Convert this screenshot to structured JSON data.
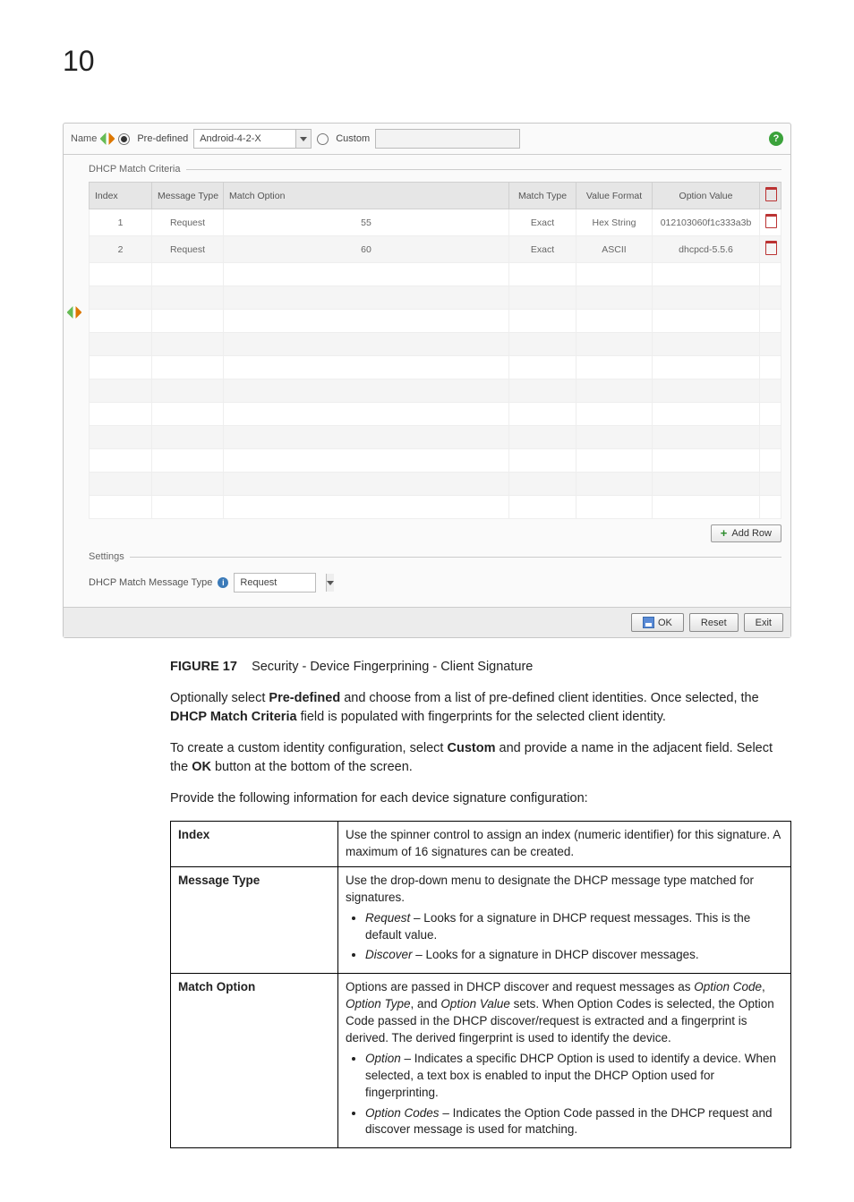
{
  "page_number": "10",
  "panel": {
    "name_label": "Name",
    "predefined_label": "Pre-defined",
    "predefined_value": "Android-4-2-X",
    "custom_label": "Custom",
    "fieldset_title": "DHCP Match Criteria",
    "headers": {
      "index": "Index",
      "message_type": "Message Type",
      "match_option": "Match Option",
      "match_type": "Match Type",
      "value_format": "Value Format",
      "option_value": "Option Value"
    },
    "rows": [
      {
        "index": "1",
        "message_type": "Request",
        "match_option": "55",
        "match_type": "Exact",
        "value_format": "Hex String",
        "option_value": "012103060f1c333a3b"
      },
      {
        "index": "2",
        "message_type": "Request",
        "match_option": "60",
        "match_type": "Exact",
        "value_format": "ASCII",
        "option_value": "dhcpcd-5.5.6"
      }
    ],
    "add_row_label": "Add Row",
    "settings_title": "Settings",
    "settings_field_label": "DHCP Match Message Type",
    "settings_field_value": "Request",
    "buttons": {
      "ok": "OK",
      "reset": "Reset",
      "exit": "Exit"
    }
  },
  "figure": {
    "id": "FIGURE 17",
    "caption": "Security - Device Fingerprining - Client Signature"
  },
  "paragraphs": {
    "p1a": "Optionally select ",
    "p1b": "Pre-defined",
    "p1c": " and choose from a list of pre-defined client identities. Once selected, the ",
    "p1d": "DHCP Match Criteria",
    "p1e": " field is populated with fingerprints for the selected client identity.",
    "p2a": "To create a custom identity configuration, select ",
    "p2b": "Custom",
    "p2c": " and provide a name in the adjacent field. Select the ",
    "p2d": "OK",
    "p2e": " button at the bottom of the screen.",
    "p3": "Provide the following information for each device signature configuration:"
  },
  "desc_table": {
    "index": {
      "k": "Index",
      "v": "Use the spinner control to assign an index (numeric identifier) for this signature. A maximum of 16 signatures can be created."
    },
    "message_type": {
      "k": "Message Type",
      "intro": "Use the drop-down menu to designate the DHCP message type matched for signatures.",
      "li1_em": "Request",
      "li1_rest": " – Looks for a signature in DHCP request messages. This is the default value.",
      "li2_em": "Discover",
      "li2_rest": " – Looks for a signature in DHCP discover messages."
    },
    "match_option": {
      "k": "Match Option",
      "intro_a": "Options are passed in DHCP discover and request messages as ",
      "intro_em1": "Option Code",
      "intro_sep1": ", ",
      "intro_em2": "Option Type",
      "intro_sep2": ", and ",
      "intro_em3": "Option Value",
      "intro_b": " sets. When Option Codes is selected, the Option Code passed in the DHCP discover/request is extracted and a fingerprint is derived. The derived fingerprint is used to identify the device.",
      "li1_em": "Option",
      "li1_rest": " – Indicates a specific DHCP Option is used to identify a device. When selected, a text box is enabled to input the DHCP Option used for fingerprinting.",
      "li2_em": "Option Codes",
      "li2_rest": " – Indicates the Option Code passed in the DHCP request and discover message is used for matching."
    }
  }
}
